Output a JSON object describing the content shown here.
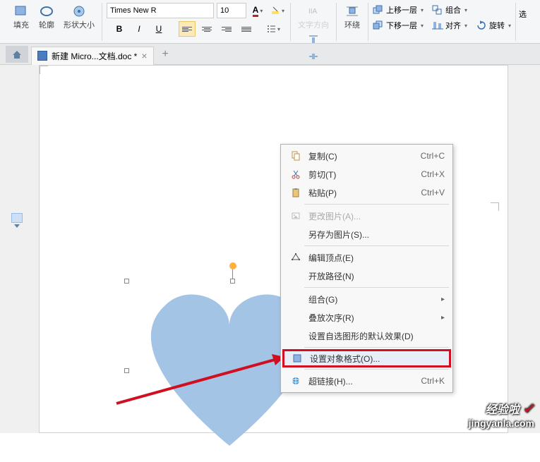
{
  "ribbon": {
    "fill_label": "填充",
    "outline_label": "轮廓",
    "shape_size_label": "形状大小",
    "font_name": "Times New R",
    "font_size": "10",
    "text_direction_label": "文字方向",
    "wrap_label": "环绕",
    "bring_forward_label": "上移一层",
    "send_backward_label": "下移一层",
    "align_label": "对齐",
    "group_label": "组合",
    "rotate_label": "旋转",
    "select_label": "选"
  },
  "tab": {
    "doc_name": "新建 Micro...文档.doc *"
  },
  "context_menu": {
    "items": [
      {
        "label": "复制(C)",
        "shortcut": "Ctrl+C",
        "icon": "copy"
      },
      {
        "label": "剪切(T)",
        "shortcut": "Ctrl+X",
        "icon": "cut"
      },
      {
        "label": "粘贴(P)",
        "shortcut": "Ctrl+V",
        "icon": "paste"
      },
      {
        "divider": true
      },
      {
        "label": "更改图片(A)...",
        "disabled": true,
        "icon": "image"
      },
      {
        "label": "另存为图片(S)...",
        "shortcut": ""
      },
      {
        "divider": true
      },
      {
        "label": "编辑顶点(E)",
        "icon": "vertex"
      },
      {
        "label": "开放路径(N)"
      },
      {
        "divider": true
      },
      {
        "label": "组合(G)",
        "submenu": true
      },
      {
        "label": "叠放次序(R)",
        "submenu": true
      },
      {
        "label": "设置自选图形的默认效果(D)"
      },
      {
        "divider": true
      },
      {
        "label": "设置对象格式(O)...",
        "icon": "format",
        "highlighted": true
      },
      {
        "divider": true
      },
      {
        "label": "超链接(H)...",
        "shortcut": "Ctrl+K",
        "icon": "link"
      }
    ]
  },
  "watermark": {
    "top": "经验啦",
    "bottom": "jingyanla.com"
  }
}
